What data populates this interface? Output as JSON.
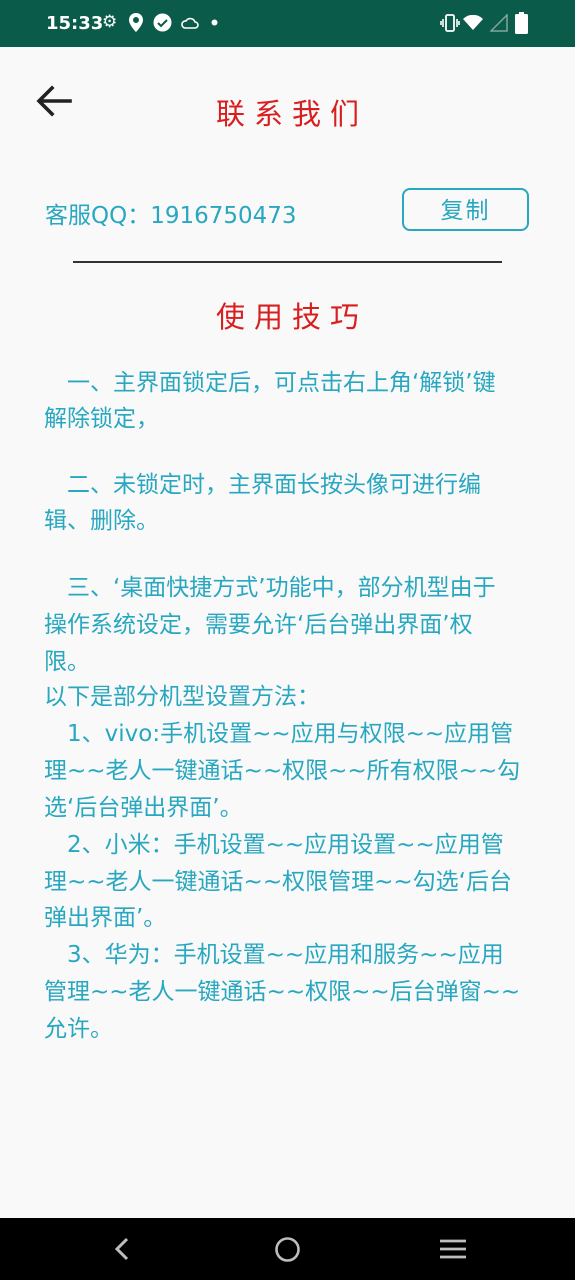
{
  "status_bar": {
    "time": "15:33",
    "left_icons": [
      "gear-icon",
      "location-icon",
      "check-circle-icon",
      "cloud-icon",
      "dot-icon"
    ],
    "right_icons": [
      "vibrate-icon",
      "wifi-icon",
      "signal-icon",
      "battery-icon"
    ]
  },
  "header": {
    "title": "联系我们"
  },
  "contact": {
    "qq_text": "客服QQ：1916750473",
    "copy_label": "复制"
  },
  "tips": {
    "title": "使用技巧",
    "lines": [
      "　一、主界面锁定后，可点击右上角‘解锁’键",
      "解除锁定，",
      "　二、未锁定时，主界面长按头像可进行编",
      "辑、删除。",
      "　三、‘桌面快捷方式’功能中，部分机型由于",
      "操作系统设定，需要允许‘后台弹出界面’权",
      "限。",
      "以下是部分机型设置方法：",
      "　1、vivo:手机设置~~应用与权限~~应用管",
      "理~~老人一键通话~~权限~~所有权限~~勾",
      "选‘后台弹出界面’。",
      "　2、小米：手机设置~~应用设置~~应用管",
      "理~~老人一键通话~~权限管理~~勾选‘后台",
      "弹出界面’。",
      "　3、华为：手机设置~~应用和服务~~应用",
      "管理~~老人一键通话~~权限~~后台弹窗~~",
      "允许。"
    ]
  },
  "nav_bar": {
    "buttons": [
      "back-icon",
      "home-icon",
      "recents-icon"
    ]
  },
  "colors": {
    "accent_teal": "#28a7c0",
    "title_red": "#d81e1e",
    "status_bar": "#0b5b4a"
  }
}
